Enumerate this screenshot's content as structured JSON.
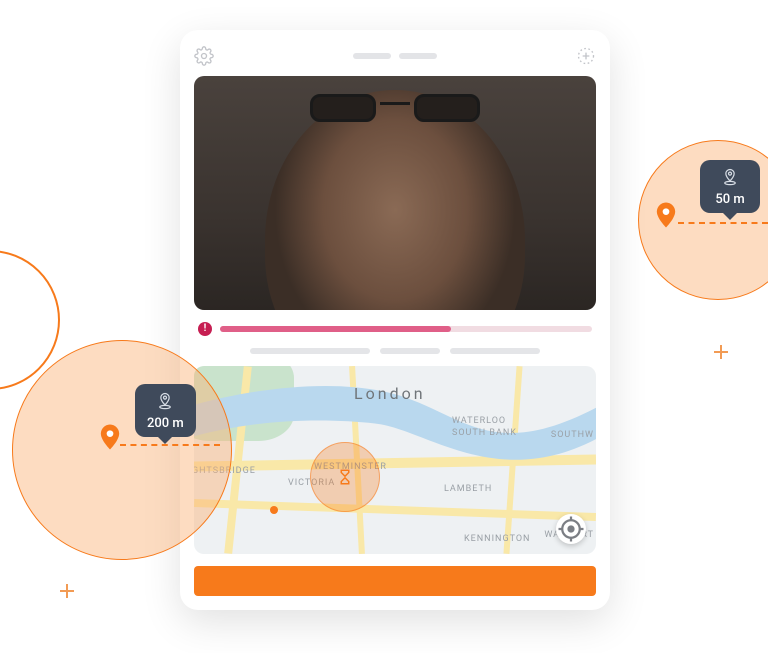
{
  "colors": {
    "accent": "#F77A1B",
    "slider": "#E05F88",
    "slider_badge": "#C61E52",
    "tooltip_bg": "#3F4A5B"
  },
  "slider": {
    "percent": 62,
    "badge": "!"
  },
  "map": {
    "city_label": "London",
    "labels": {
      "ghtsbridge": "GHTSBRIDGE",
      "westminster": "WESTMINSTER",
      "victoria": "VICTORIA",
      "waterloo1": "WATERLOO",
      "waterloo2": "SOUTH BANK",
      "lambeth": "LAMBETH",
      "southwark": "SOUTHW",
      "kennington": "KENNINGTON",
      "walworth": "WALWORT"
    }
  },
  "callouts": {
    "left": {
      "distance": "200 m"
    },
    "right": {
      "distance": "50 m"
    }
  }
}
